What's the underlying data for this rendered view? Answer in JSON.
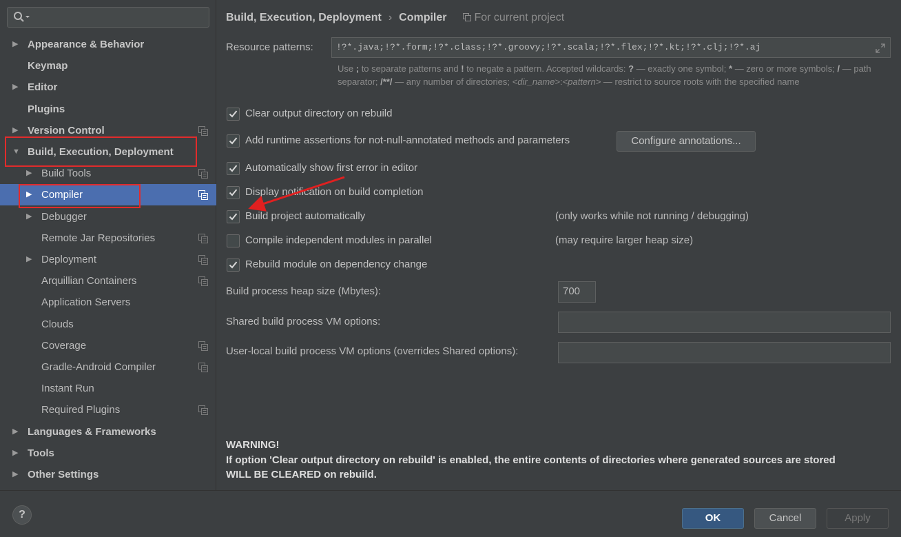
{
  "search": {
    "placeholder": "",
    "value": ""
  },
  "sidebar": {
    "items": [
      {
        "label": "Appearance & Behavior",
        "level": 0,
        "expandable": true,
        "expanded": false,
        "bold": true,
        "project_icon": false,
        "selected": false
      },
      {
        "label": "Keymap",
        "level": 0,
        "expandable": false,
        "bold": true,
        "project_icon": false,
        "selected": false
      },
      {
        "label": "Editor",
        "level": 0,
        "expandable": true,
        "expanded": false,
        "bold": true,
        "project_icon": false,
        "selected": false
      },
      {
        "label": "Plugins",
        "level": 0,
        "expandable": false,
        "bold": true,
        "project_icon": false,
        "selected": false
      },
      {
        "label": "Version Control",
        "level": 0,
        "expandable": true,
        "expanded": false,
        "bold": true,
        "project_icon": true,
        "selected": false
      },
      {
        "label": "Build, Execution, Deployment",
        "level": 0,
        "expandable": true,
        "expanded": true,
        "bold": true,
        "project_icon": false,
        "selected": false
      },
      {
        "label": "Build Tools",
        "level": 1,
        "expandable": true,
        "expanded": false,
        "bold": false,
        "project_icon": true,
        "selected": false
      },
      {
        "label": "Compiler",
        "level": 1,
        "expandable": true,
        "expanded": false,
        "bold": false,
        "project_icon": true,
        "selected": true
      },
      {
        "label": "Debugger",
        "level": 1,
        "expandable": true,
        "expanded": false,
        "bold": false,
        "project_icon": false,
        "selected": false
      },
      {
        "label": "Remote Jar Repositories",
        "level": 1,
        "expandable": false,
        "bold": false,
        "project_icon": true,
        "selected": false
      },
      {
        "label": "Deployment",
        "level": 1,
        "expandable": true,
        "expanded": false,
        "bold": false,
        "project_icon": true,
        "selected": false
      },
      {
        "label": "Arquillian Containers",
        "level": 1,
        "expandable": false,
        "bold": false,
        "project_icon": true,
        "selected": false
      },
      {
        "label": "Application Servers",
        "level": 1,
        "expandable": false,
        "bold": false,
        "project_icon": false,
        "selected": false
      },
      {
        "label": "Clouds",
        "level": 1,
        "expandable": false,
        "bold": false,
        "project_icon": false,
        "selected": false
      },
      {
        "label": "Coverage",
        "level": 1,
        "expandable": false,
        "bold": false,
        "project_icon": true,
        "selected": false
      },
      {
        "label": "Gradle-Android Compiler",
        "level": 1,
        "expandable": false,
        "bold": false,
        "project_icon": true,
        "selected": false
      },
      {
        "label": "Instant Run",
        "level": 1,
        "expandable": false,
        "bold": false,
        "project_icon": false,
        "selected": false
      },
      {
        "label": "Required Plugins",
        "level": 1,
        "expandable": false,
        "bold": false,
        "project_icon": true,
        "selected": false
      },
      {
        "label": "Languages & Frameworks",
        "level": 0,
        "expandable": true,
        "expanded": false,
        "bold": true,
        "project_icon": false,
        "selected": false
      },
      {
        "label": "Tools",
        "level": 0,
        "expandable": true,
        "expanded": false,
        "bold": true,
        "project_icon": false,
        "selected": false
      },
      {
        "label": "Other Settings",
        "level": 0,
        "expandable": true,
        "expanded": false,
        "bold": true,
        "project_icon": false,
        "selected": false
      }
    ]
  },
  "breadcrumb": {
    "parent": "Build, Execution, Deployment",
    "separator": "›",
    "current": "Compiler",
    "scope": "For current project"
  },
  "resource_patterns": {
    "label": "Resource patterns:",
    "value": "!?*.java;!?*.form;!?*.class;!?*.groovy;!?*.scala;!?*.flex;!?*.kt;!?*.clj;!?*.aj"
  },
  "hint": {
    "p1": "Use ",
    "k1": ";",
    "p2": " to separate patterns and ",
    "k2": "!",
    "p3": " to negate a pattern. Accepted wildcards: ",
    "k3": "?",
    "p4": " — exactly one symbol; ",
    "k4": "*",
    "p5": " — zero or more symbols; ",
    "k5": "/",
    "p6": " — path separator; ",
    "k6": "/**/",
    "p7": " — any number of directories; ",
    "k7": "<dir_name>",
    "p8": ":",
    "k8": "<pattern>",
    "p9": " — restrict to source roots with the specified name"
  },
  "options": [
    {
      "label": "Clear output directory on rebuild",
      "checked": true,
      "note": ""
    },
    {
      "label": "Add runtime assertions for not-null-annotated methods and parameters",
      "checked": true,
      "note": ""
    },
    {
      "label": "Automatically show first error in editor",
      "checked": true,
      "note": ""
    },
    {
      "label": "Display notification on build completion",
      "checked": true,
      "note": ""
    },
    {
      "label": "Build project automatically",
      "checked": true,
      "note": "(only works while not running / debugging)"
    },
    {
      "label": "Compile independent modules in parallel",
      "checked": false,
      "note": "(may require larger heap size)"
    },
    {
      "label": "Rebuild module on dependency change",
      "checked": true,
      "note": ""
    }
  ],
  "configure_annotations_label": "Configure annotations...",
  "heap": {
    "label": "Build process heap size (Mbytes):",
    "value": "700"
  },
  "shared_vm": {
    "label": "Shared build process VM options:",
    "value": ""
  },
  "user_vm": {
    "label": "User-local build process VM options (overrides Shared options):",
    "value": ""
  },
  "warning": {
    "title": "WARNING!",
    "line1": "If option 'Clear output directory on rebuild' is enabled, the entire contents of directories where generated sources are stored",
    "line2": "WILL BE CLEARED on rebuild."
  },
  "buttons": {
    "help": "?",
    "ok": "OK",
    "cancel": "Cancel",
    "apply": "Apply"
  },
  "colors": {
    "selection": "#4b6eaf",
    "highlight_box": "#e22b2b",
    "annotation_arrow": "#e02020",
    "ok_button": "#365880"
  }
}
